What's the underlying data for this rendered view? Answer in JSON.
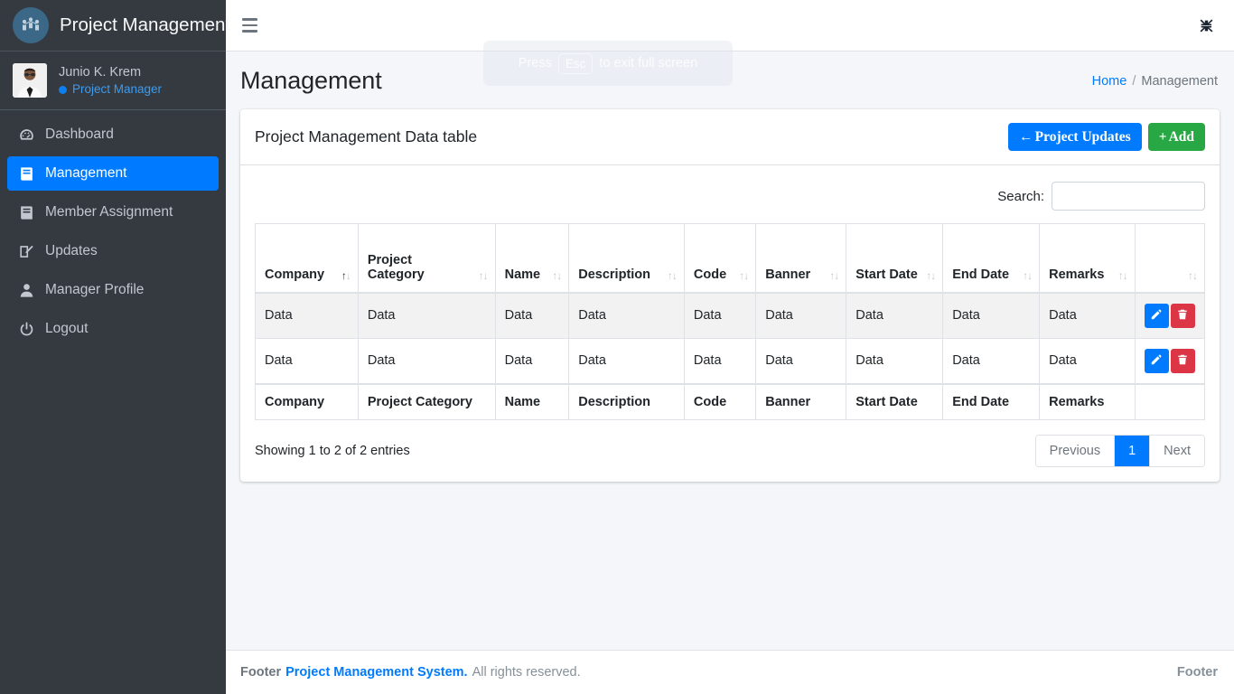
{
  "sidebar": {
    "brand_title": "Project Management",
    "brand_logo_icon": "network-people-icon",
    "user": {
      "name": "Junio K. Krem",
      "role": "Project Manager",
      "status_icon": "online-dot-icon",
      "avatar_icon": "user-avatar"
    },
    "items": [
      {
        "label": "Dashboard",
        "icon": "tachometer-icon",
        "active": false
      },
      {
        "label": "Management",
        "icon": "book-icon",
        "active": true
      },
      {
        "label": "Member Assignment",
        "icon": "book-reader-icon",
        "active": false
      },
      {
        "label": "Updates",
        "icon": "edit-square-icon",
        "active": false
      },
      {
        "label": "Manager Profile",
        "icon": "user-icon",
        "active": false
      },
      {
        "label": "Logout",
        "icon": "power-off-icon",
        "active": false
      }
    ]
  },
  "navbar": {
    "menu_icon": "hamburger-menu-icon",
    "fullscreen_icon": "compress-exit-fullscreen-icon"
  },
  "fullscreen_toast": {
    "prefix": "Press",
    "key": "Esc",
    "suffix": "to exit full screen"
  },
  "content_header": {
    "title": "Management",
    "breadcrumb": {
      "home": "Home",
      "separator": "/",
      "current": "Management"
    }
  },
  "card": {
    "title": "Project Management Data table",
    "buttons": {
      "updates_icon": "arrow-left-icon",
      "updates_label": "Project Updates",
      "add_icon": "plus-icon",
      "add_label": "Add"
    }
  },
  "datatable": {
    "search_label": "Search:",
    "search_value": "",
    "search_placeholder": "",
    "columns": [
      {
        "label": "Company",
        "sorted": "asc"
      },
      {
        "label": "Project Category",
        "sorted": "none"
      },
      {
        "label": "Name",
        "sorted": "none"
      },
      {
        "label": "Description",
        "sorted": "none"
      },
      {
        "label": "Code",
        "sorted": "none"
      },
      {
        "label": "Banner",
        "sorted": "none"
      },
      {
        "label": "Start Date",
        "sorted": "none"
      },
      {
        "label": "End Date",
        "sorted": "none"
      },
      {
        "label": "Remarks",
        "sorted": "none"
      },
      {
        "label": "",
        "sorted": "none"
      }
    ],
    "rows": [
      {
        "cells": [
          "Data",
          "Data",
          "Data",
          "Data",
          "Data",
          "Data",
          "Data",
          "Data",
          "Data"
        ],
        "actions": {
          "edit_icon": "pencil-edit-icon",
          "delete_icon": "trash-delete-icon"
        }
      },
      {
        "cells": [
          "Data",
          "Data",
          "Data",
          "Data",
          "Data",
          "Data",
          "Data",
          "Data",
          "Data"
        ],
        "actions": {
          "edit_icon": "pencil-edit-icon",
          "delete_icon": "trash-delete-icon"
        }
      }
    ],
    "footer_columns": [
      "Company",
      "Project Category",
      "Name",
      "Description",
      "Code",
      "Banner",
      "Start Date",
      "End Date",
      "Remarks",
      ""
    ],
    "info": "Showing 1 to 2 of 2 entries",
    "pagination": {
      "previous": "Previous",
      "pages": [
        "1"
      ],
      "current_page": "1",
      "next": "Next"
    }
  },
  "footer": {
    "prefix": "Footer",
    "brand": "Project Management System.",
    "rights": "All rights reserved.",
    "right_label": "Footer"
  },
  "colors": {
    "sidebar_bg": "#343a40",
    "accent_blue": "#007bff",
    "success_green": "#28a745",
    "danger_red": "#dc3545",
    "content_bg": "#f4f6f9"
  }
}
